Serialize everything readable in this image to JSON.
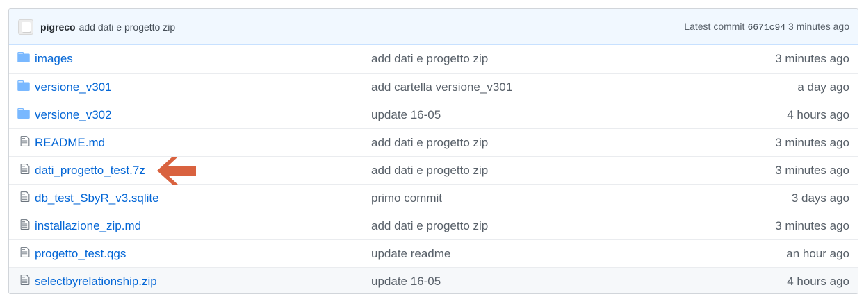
{
  "commit_bar": {
    "author": "pigreco",
    "message": "add dati e progetto zip",
    "latest_label": "Latest commit",
    "sha": "6671c94",
    "time": "3 minutes ago"
  },
  "files": [
    {
      "type": "dir",
      "icon": "folder-icon",
      "name": "images",
      "message": "add dati e progetto zip",
      "age": "3 minutes ago"
    },
    {
      "type": "dir",
      "icon": "folder-icon",
      "name": "versione_v301",
      "message": "add cartella versione_v301",
      "age": "a day ago"
    },
    {
      "type": "dir",
      "icon": "folder-icon",
      "name": "versione_v302",
      "message": "update 16-05",
      "age": "4 hours ago"
    },
    {
      "type": "file",
      "icon": "file-icon",
      "name": "README.md",
      "message": "add dati e progetto zip",
      "age": "3 minutes ago"
    },
    {
      "type": "file",
      "icon": "file-icon",
      "name": "dati_progetto_test.7z",
      "message": "add dati e progetto zip",
      "age": "3 minutes ago"
    },
    {
      "type": "file",
      "icon": "file-icon",
      "name": "db_test_SbyR_v3.sqlite",
      "message": "primo commit",
      "age": "3 days ago"
    },
    {
      "type": "file",
      "icon": "file-icon",
      "name": "installazione_zip.md",
      "message": "add dati e progetto zip",
      "age": "3 minutes ago"
    },
    {
      "type": "file",
      "icon": "file-icon",
      "name": "progetto_test.qgs",
      "message": "update readme",
      "age": "an hour ago"
    },
    {
      "type": "file",
      "icon": "file-icon",
      "name": "selectbyrelationship.zip",
      "message": "update 16-05",
      "age": "4 hours ago"
    }
  ],
  "colors": {
    "link": "#0366d6",
    "muted": "#586069",
    "folder": "#79b8ff",
    "annotation_arrow": "#d9623f",
    "commit_bar_bg": "#f1f8ff"
  },
  "annotation": {
    "icon": "arrow-left-icon",
    "points_to": "dati_progetto_test.7z"
  }
}
